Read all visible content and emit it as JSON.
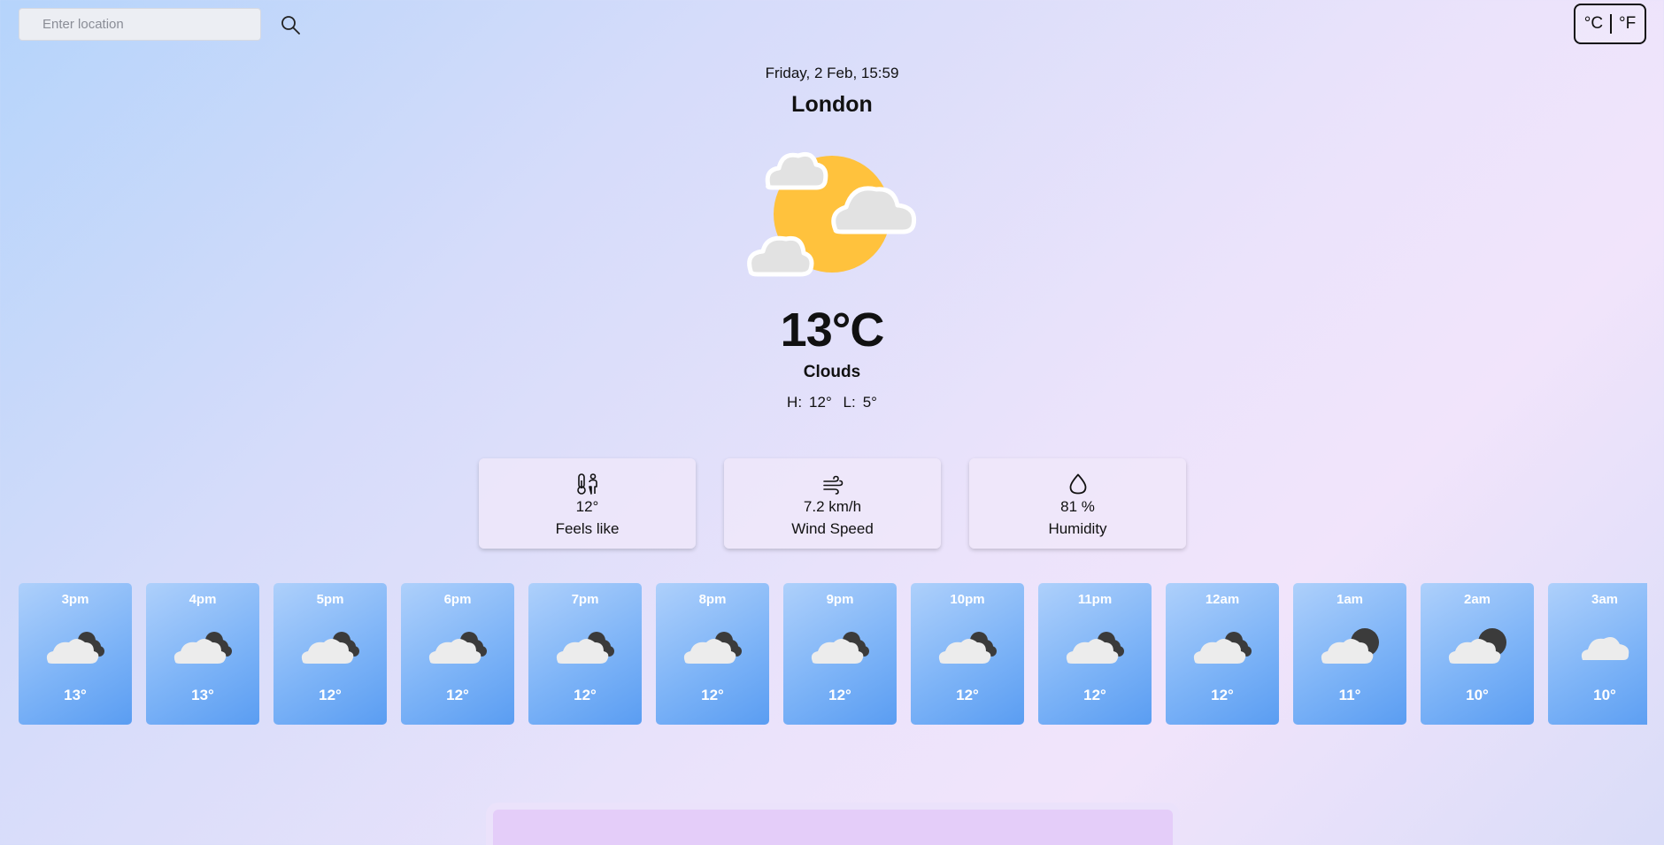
{
  "search": {
    "placeholder": "Enter location"
  },
  "units": {
    "celsius": "°C",
    "fahrenheit": "°F"
  },
  "current": {
    "datetime": "Friday, 2 Feb, 15:59",
    "city": "London",
    "temperature": "13°C",
    "condition": "Clouds",
    "high_label": "H:",
    "high": "12°",
    "low_label": "L:",
    "low": "5°",
    "icon": "sun-behind-clouds-icon"
  },
  "stats": [
    {
      "icon": "thermometer-person-icon",
      "value": "12°",
      "label": "Feels like"
    },
    {
      "icon": "wind-icon",
      "value": "7.2 km/h",
      "label": "Wind Speed"
    },
    {
      "icon": "droplet-icon",
      "value": "81 %",
      "label": "Humidity"
    }
  ],
  "hourly": [
    {
      "time": "3pm",
      "temp": "13°",
      "icon": "broken-clouds-day-icon"
    },
    {
      "time": "4pm",
      "temp": "13°",
      "icon": "broken-clouds-day-icon"
    },
    {
      "time": "5pm",
      "temp": "12°",
      "icon": "broken-clouds-day-icon"
    },
    {
      "time": "6pm",
      "temp": "12°",
      "icon": "broken-clouds-day-icon"
    },
    {
      "time": "7pm",
      "temp": "12°",
      "icon": "broken-clouds-day-icon"
    },
    {
      "time": "8pm",
      "temp": "12°",
      "icon": "broken-clouds-day-icon"
    },
    {
      "time": "9pm",
      "temp": "12°",
      "icon": "broken-clouds-day-icon"
    },
    {
      "time": "10pm",
      "temp": "12°",
      "icon": "broken-clouds-day-icon"
    },
    {
      "time": "11pm",
      "temp": "12°",
      "icon": "broken-clouds-day-icon"
    },
    {
      "time": "12am",
      "temp": "12°",
      "icon": "broken-clouds-day-icon"
    },
    {
      "time": "1am",
      "temp": "11°",
      "icon": "cloud-moon-icon"
    },
    {
      "time": "2am",
      "temp": "10°",
      "icon": "cloud-moon-icon"
    },
    {
      "time": "3am",
      "temp": "10°",
      "icon": "cloud-icon"
    }
  ]
}
